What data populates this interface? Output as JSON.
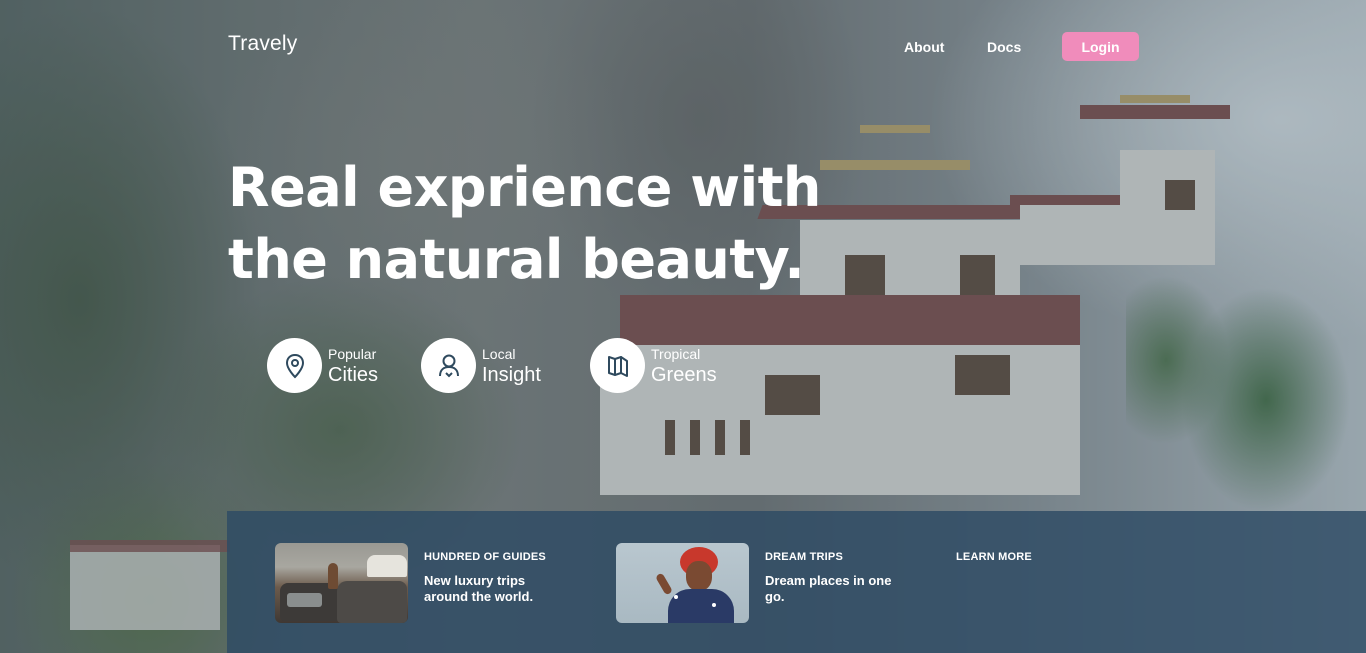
{
  "nav": {
    "brand": "Travely",
    "links": [
      "About",
      "Docs"
    ],
    "login_label": "Login",
    "login_color": "#f08cbb"
  },
  "hero": {
    "headline_line1": "Real exprience with",
    "headline_line2": "the natural beauty."
  },
  "features": [
    {
      "small": "Popular",
      "big": "Cities",
      "icon": "map-pin-icon"
    },
    {
      "small": "Local",
      "big": "Insight",
      "icon": "user-icon"
    },
    {
      "small": "Tropical",
      "big": "Greens",
      "icon": "map-icon"
    }
  ],
  "panel": {
    "cards": [
      {
        "title": "HUNDRED OF GUIDES",
        "desc": "New luxury trips around the world.",
        "image": "photo-car-travelers"
      },
      {
        "title": "DREAM TRIPS",
        "desc": "Dream places in one go.",
        "image": "photo-smiling-woman"
      }
    ],
    "learn_more": "LEARN MORE"
  }
}
